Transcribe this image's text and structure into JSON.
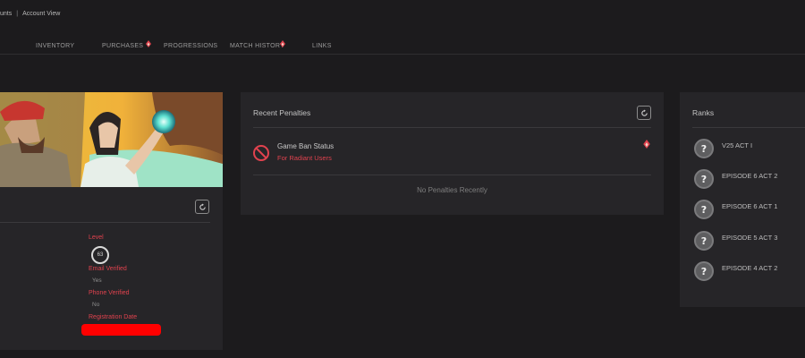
{
  "breadcrumb": {
    "parent": "unts",
    "separator": "|",
    "current": "Account View"
  },
  "nav": {
    "tabs": [
      "INVENTORY",
      "PURCHASES",
      "PROGRESSIONS",
      "MATCH HISTORY",
      "LINKS"
    ]
  },
  "profile": {
    "level_label": "Level",
    "level_value": "63",
    "email_label": "Email Verified",
    "email_value": "Yes",
    "phone_label": "Phone Verified",
    "phone_value": "No",
    "registration_label": "Registration Date"
  },
  "penalties": {
    "title": "Recent Penalties",
    "ban_title": "Game Ban Status",
    "ban_subtitle": "For Radiant Users",
    "empty": "No Penalties Recently"
  },
  "ranks": {
    "title": "Ranks",
    "items": [
      {
        "label": "V25 ACT I",
        "icon": "?"
      },
      {
        "label": "EPISODE 6 ACT 2",
        "icon": "?"
      },
      {
        "label": "EPISODE 6 ACT 1",
        "icon": "?"
      },
      {
        "label": "EPISODE 5 ACT 3",
        "icon": "?"
      },
      {
        "label": "EPISODE 4 ACT 2",
        "icon": "?"
      }
    ]
  },
  "colors": {
    "accent": "#e0424e",
    "background": "#1c1b1d",
    "panel": "#262528",
    "redaction": "#ff0000"
  }
}
